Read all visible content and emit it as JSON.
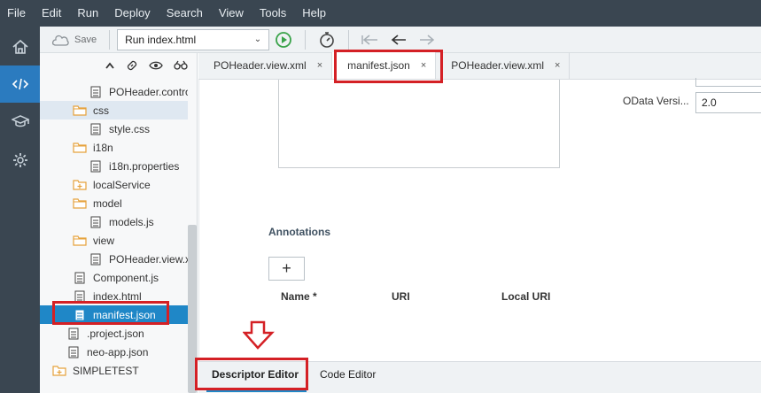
{
  "menu": [
    "File",
    "Edit",
    "Run",
    "Deploy",
    "Search",
    "View",
    "Tools",
    "Help"
  ],
  "toolbar": {
    "save_label": "Save",
    "run_config": "Run index.html"
  },
  "tree": {
    "items": [
      {
        "label": "POHeader.contro",
        "type": "file"
      },
      {
        "label": "css",
        "type": "folder"
      },
      {
        "label": "style.css",
        "type": "file"
      },
      {
        "label": "i18n",
        "type": "folder"
      },
      {
        "label": "i18n.properties",
        "type": "file"
      },
      {
        "label": "localService",
        "type": "folder-plus"
      },
      {
        "label": "model",
        "type": "folder"
      },
      {
        "label": "models.js",
        "type": "file"
      },
      {
        "label": "view",
        "type": "folder"
      },
      {
        "label": "POHeader.view.x",
        "type": "file"
      },
      {
        "label": "Component.js",
        "type": "file"
      },
      {
        "label": "index.html",
        "type": "file"
      },
      {
        "label": "manifest.json",
        "type": "file"
      },
      {
        "label": ".project.json",
        "type": "file"
      },
      {
        "label": "neo-app.json",
        "type": "file"
      },
      {
        "label": "SIMPLETEST",
        "type": "folder-plus"
      }
    ]
  },
  "tabs": [
    {
      "label": "POHeader.view.xml",
      "close": "×"
    },
    {
      "label": "manifest.json",
      "close": "×"
    },
    {
      "label": "POHeader.view.xml",
      "close": "×"
    }
  ],
  "editor": {
    "odata_label": "OData Versi...",
    "odata_value": "2.0",
    "annotations_title": "Annotations",
    "add_symbol": "+",
    "columns": {
      "name": "Name *",
      "uri": "URI",
      "local_uri": "Local URI"
    }
  },
  "bottom_tabs": {
    "descriptor": "Descriptor Editor",
    "code": "Code Editor"
  },
  "colors": {
    "accent": "#1f87c7",
    "rail": "#3a4651",
    "highlight": "#d42025"
  }
}
